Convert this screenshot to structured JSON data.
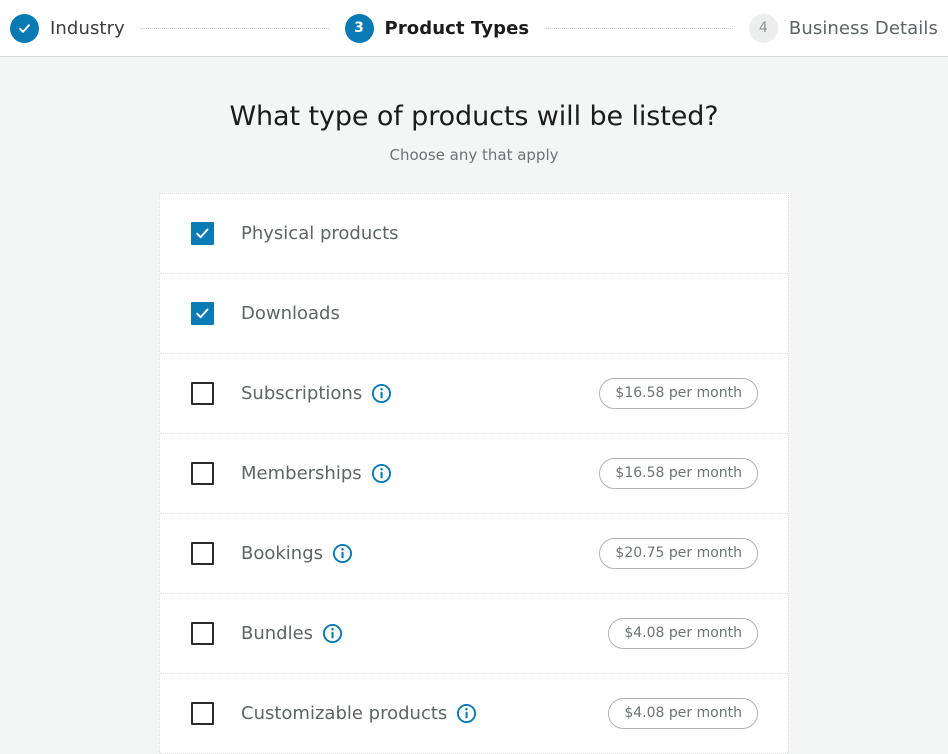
{
  "stepper": {
    "steps": [
      {
        "id": "industry",
        "number": "",
        "label": "Industry",
        "state": "done",
        "icon": "check-icon"
      },
      {
        "id": "product-types",
        "number": "3",
        "label": "Product Types",
        "state": "active",
        "icon": ""
      },
      {
        "id": "business-details",
        "number": "4",
        "label": "Business Details",
        "state": "todo",
        "icon": ""
      }
    ]
  },
  "main": {
    "title": "What type of products will be listed?",
    "subtitle": "Choose any that apply"
  },
  "options": [
    {
      "id": "physical-products",
      "label": "Physical products",
      "checked": true,
      "info": false,
      "price": ""
    },
    {
      "id": "downloads",
      "label": "Downloads",
      "checked": true,
      "info": false,
      "price": ""
    },
    {
      "id": "subscriptions",
      "label": "Subscriptions",
      "checked": false,
      "info": true,
      "price": "$16.58 per month"
    },
    {
      "id": "memberships",
      "label": "Memberships",
      "checked": false,
      "info": true,
      "price": "$16.58 per month"
    },
    {
      "id": "bookings",
      "label": "Bookings",
      "checked": false,
      "info": true,
      "price": "$20.75 per month"
    },
    {
      "id": "bundles",
      "label": "Bundles",
      "checked": false,
      "info": true,
      "price": "$4.08 per month"
    },
    {
      "id": "customizable-products",
      "label": "Customizable products",
      "checked": false,
      "info": true,
      "price": "$4.08 per month"
    }
  ],
  "colors": {
    "accent": "#0a7ab5",
    "page_background": "#f4f6f6",
    "card_background": "#ffffff",
    "divider": "#dcdedf",
    "label_text": "#5e6568"
  }
}
